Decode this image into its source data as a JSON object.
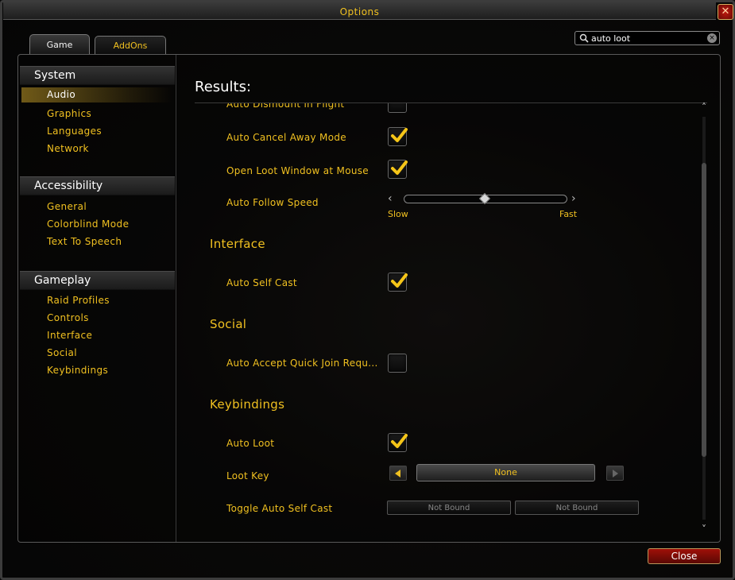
{
  "window": {
    "title": "Options",
    "close_glyph": "✕"
  },
  "tabs": [
    {
      "label": "Game",
      "active": true
    },
    {
      "label": "AddOns",
      "active": false
    }
  ],
  "search": {
    "value": "auto loot",
    "icon": "search-icon",
    "clear_glyph": "×"
  },
  "sidebar": {
    "categories": [
      {
        "title": "System",
        "items": [
          "Audio",
          "Graphics",
          "Languages",
          "Network"
        ]
      },
      {
        "title": "Accessibility",
        "items": [
          "General",
          "Colorblind Mode",
          "Text To Speech"
        ]
      },
      {
        "title": "Gameplay",
        "items": [
          "Raid Profiles",
          "Controls",
          "Interface",
          "Social",
          "Keybindings"
        ]
      }
    ],
    "selected": "Audio"
  },
  "results": {
    "title": "Results:",
    "controls": {
      "auto_dismount": {
        "label": "Auto Dismount in Flight",
        "checked": false
      },
      "auto_cancel_away": {
        "label": "Auto Cancel Away Mode",
        "checked": true
      },
      "open_loot_mouse": {
        "label": "Open Loot Window at Mouse",
        "checked": true
      },
      "auto_follow_speed": {
        "label": "Auto Follow Speed",
        "min_label": "Slow",
        "max_label": "Fast",
        "value_fraction": 0.5
      }
    },
    "sections": {
      "interface": {
        "title": "Interface",
        "auto_self_cast": {
          "label": "Auto Self Cast",
          "checked": true
        }
      },
      "social": {
        "title": "Social",
        "auto_accept_quick_join": {
          "label": "Auto Accept Quick Join Requ...",
          "checked": false
        }
      },
      "keybindings": {
        "title": "Keybindings",
        "auto_loot": {
          "label": "Auto Loot",
          "checked": true
        },
        "loot_key": {
          "label": "Loot Key",
          "value": "None"
        },
        "toggle_auto_self_cast": {
          "label": "Toggle Auto Self Cast",
          "binding1": "Not Bound",
          "binding2": "Not Bound"
        }
      }
    }
  },
  "footer": {
    "close_label": "Close"
  },
  "colors": {
    "accent_gold": "#f0c020",
    "close_red": "#a01008",
    "check_gold": "#f5c518"
  }
}
